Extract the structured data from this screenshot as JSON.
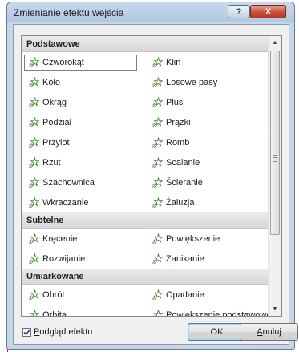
{
  "dialog": {
    "title": "Zmienianie efektu wejścia",
    "help_button": "?",
    "close_button": "X"
  },
  "groups": [
    {
      "header": "Podstawowe",
      "items": [
        {
          "label": "Czworokąt",
          "icon": "star-effect-icon",
          "selected": true
        },
        {
          "label": "Klin",
          "icon": "star-effect-icon"
        },
        {
          "label": "Koło",
          "icon": "star-effect-icon"
        },
        {
          "label": "Losowe pasy",
          "icon": "star-effect-icon"
        },
        {
          "label": "Okrąg",
          "icon": "star-effect-icon"
        },
        {
          "label": "Plus",
          "icon": "star-effect-icon"
        },
        {
          "label": "Podział",
          "icon": "star-effect-icon"
        },
        {
          "label": "Prążki",
          "icon": "star-effect-icon"
        },
        {
          "label": "Przylot",
          "icon": "star-effect-icon"
        },
        {
          "label": "Romb",
          "icon": "star-effect-icon"
        },
        {
          "label": "Rzut",
          "icon": "star-effect-icon"
        },
        {
          "label": "Scalanie",
          "icon": "star-effect-icon"
        },
        {
          "label": "Szachownica",
          "icon": "star-effect-icon"
        },
        {
          "label": "Ścieranie",
          "icon": "star-effect-icon"
        },
        {
          "label": "Wkraczanie",
          "icon": "star-effect-icon"
        },
        {
          "label": "Żaluzja",
          "icon": "star-effect-icon"
        }
      ]
    },
    {
      "header": "Subtelne",
      "items": [
        {
          "label": "Kręcenie",
          "icon": "star-effect-icon"
        },
        {
          "label": "Powiększenie",
          "icon": "star-effect-icon"
        },
        {
          "label": "Rozwijanie",
          "icon": "star-effect-icon"
        },
        {
          "label": "Zanikanie",
          "icon": "star-effect-icon"
        }
      ]
    },
    {
      "header": "Umiarkowane",
      "items": [
        {
          "label": "Obrót",
          "icon": "star-effect-icon"
        },
        {
          "label": "Opadanie",
          "icon": "star-effect-icon"
        },
        {
          "label": "Orbita",
          "icon": "star-effect-icon"
        },
        {
          "label": "Powiększenie podstawowe",
          "icon": "star-effect-icon"
        }
      ]
    }
  ],
  "footer": {
    "preview_label_accesskey": "P",
    "preview_label_rest": "odgląd efektu",
    "preview_checked": true,
    "ok_label": "OK",
    "cancel_label_accesskey": "A",
    "cancel_label_rest": "nuluj"
  },
  "colors": {
    "titlebar": "#b3c9e2",
    "dialog_background": "#f0f0f0",
    "group_header": "#dedede",
    "annotation_line": "#b22a30",
    "star_icon_green": "#3e8a2b"
  }
}
